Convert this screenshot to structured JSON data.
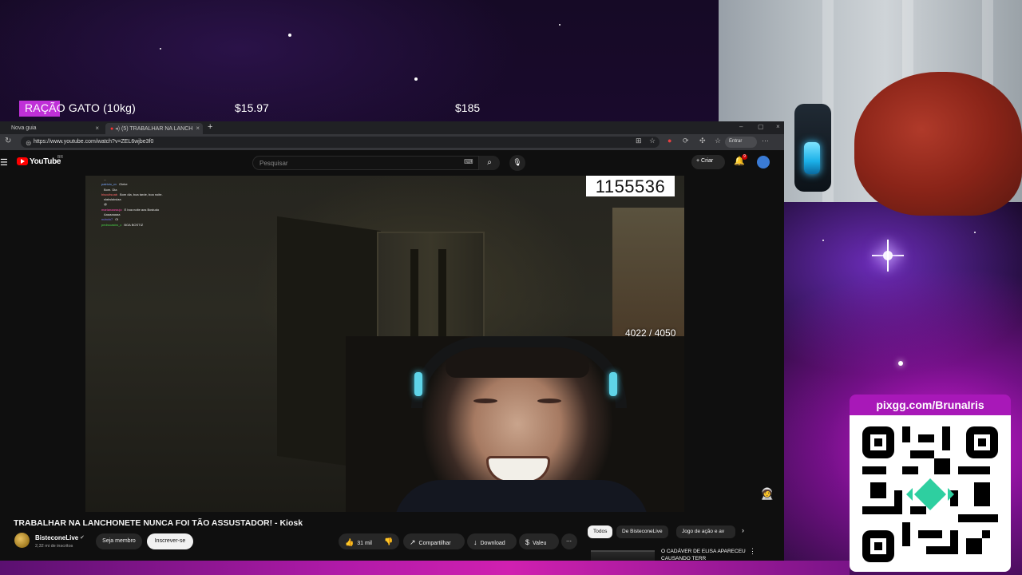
{
  "goal": {
    "item": "RAÇÃO GATO (10kg)",
    "current": "$15.97",
    "target": "$185",
    "progress_fraction": 0.086
  },
  "browser": {
    "tabs": [
      {
        "label": "Nova guia",
        "active": false
      },
      {
        "label": "(5) TRABALHAR NA LANCH",
        "active": true
      }
    ],
    "url": "https://www.youtube.com/watch?v=ZEL6wjbe3f0",
    "signin_label": "Entrar"
  },
  "youtube": {
    "wordmark": "YouTube",
    "country": "BR",
    "search_placeholder": "Pesquisar",
    "create_label": "Criar",
    "notification_count": "9",
    "video": {
      "counter": "1155536",
      "subgoal": "4022 / 4050",
      "title": "TRABALHAR NA LANCHONETE NUNCA FOI TÃO ASSUSTADOR! - Kiosk"
    },
    "chat": [
      {
        "user": "",
        "msg": "...",
        "color": "#b87dd8"
      },
      {
        "user": "patricio_cv",
        "msg": "Oieke",
        "color": "#7aa8ff"
      },
      {
        "user": "",
        "msg": "Bom. Dia",
        "color": "#7aa8ff"
      },
      {
        "user": "biscuitsoab",
        "msg": "Bom dia, boa tarde, boa noite.",
        "color": "#ff6a6a"
      },
      {
        "user": "",
        "msg": "slakslakslaa",
        "color": "#7aa8ff"
      },
      {
        "user": "",
        "msg": "@",
        "color": "#ff8a3a"
      },
      {
        "user": "marianaaraujo",
        "msg": "E boa noite aos Bostudo",
        "color": "#ff4ab0"
      },
      {
        "user": "",
        "msg": "Aaaaaaaaa",
        "color": "#ff4a4a"
      },
      {
        "user": "nubolo7",
        "msg": "Oi",
        "color": "#7a7aff"
      },
      {
        "user": "pedrocastro_c",
        "msg": "BOA BOSTIZ",
        "color": "#4ad84a"
      }
    ],
    "channel": {
      "name": "BisteconeLive",
      "subscribers": "2,32 mi de inscritos",
      "join_label": "Seja membro",
      "subscribe_label": "Inscrever-se"
    },
    "actions": {
      "likes": "31 mil",
      "share": "Compartilhar",
      "download": "Download",
      "thanks": "Valeu"
    },
    "filters": [
      "Todos",
      "De BisteconeLive",
      "Jogo de ação e av"
    ],
    "recommendation": {
      "title": "O CADÁVER DE ELISA APARECEU CAUSANDO TERR"
    }
  },
  "pix": {
    "label": "pixgg.com/BrunaIris"
  },
  "colors": {
    "goal_fill": "#c030d8",
    "pix_label_bg": "#a818b8",
    "youtube_red": "#ff0000"
  }
}
